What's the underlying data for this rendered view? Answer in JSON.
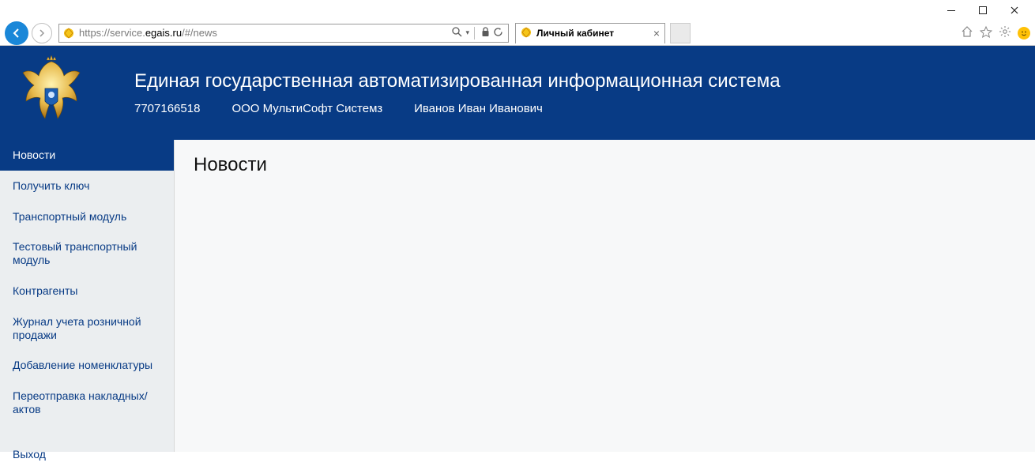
{
  "browser": {
    "url_prefix": "https://",
    "url_host_grey1": "service.",
    "url_host_main": "egais.ru",
    "url_path": "/#/news",
    "tab_title": "Личный кабинет"
  },
  "header": {
    "title": "Единая государственная автоматизированная информационная система",
    "inn": "7707166518",
    "org": "ООО МультиСофт Системз",
    "user": "Иванов Иван Иванович"
  },
  "sidebar": {
    "items": [
      {
        "label": "Новости",
        "active": true
      },
      {
        "label": "Получить ключ",
        "active": false
      },
      {
        "label": "Транспортный модуль",
        "active": false
      },
      {
        "label": "Тестовый транспортный модуль",
        "active": false
      },
      {
        "label": "Контрагенты",
        "active": false
      },
      {
        "label": "Журнал учета розничной продажи",
        "active": false
      },
      {
        "label": "Добавление номенклатуры",
        "active": false
      },
      {
        "label": "Переотправка накладных/актов",
        "active": false
      },
      {
        "label": "Выход",
        "active": false
      }
    ]
  },
  "content": {
    "title": "Новости"
  }
}
